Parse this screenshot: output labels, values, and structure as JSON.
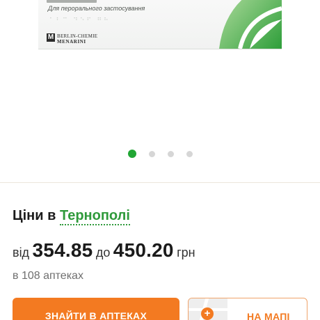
{
  "product_image": {
    "usage_text": "Для перорального застосування",
    "braille_text": "⠁⠃⠉ ⠙⠑⠋ ⠛⠓",
    "manufacturer_logo": {
      "mark": "M",
      "name": "BERLIN-CHEMIE",
      "sub": "MENARINI"
    },
    "accent_color": "#3fae3c"
  },
  "carousel": {
    "total_slides": 4,
    "active_slide": 1,
    "active_color": "#21a634"
  },
  "prices": {
    "title_prefix": "Ціни в",
    "city": "Тернополі",
    "from_label": "від",
    "min_price": "354.85",
    "to_label": "до",
    "max_price": "450.20",
    "currency": "грн",
    "pharmacies_text": "в 108 аптеках"
  },
  "buttons": {
    "find_label": "ЗНАЙТИ В АПТЕКАХ",
    "map_label": "НА МАПІ",
    "map_icon": "map-pin-plus-icon",
    "accent_color": "#f37a21"
  }
}
